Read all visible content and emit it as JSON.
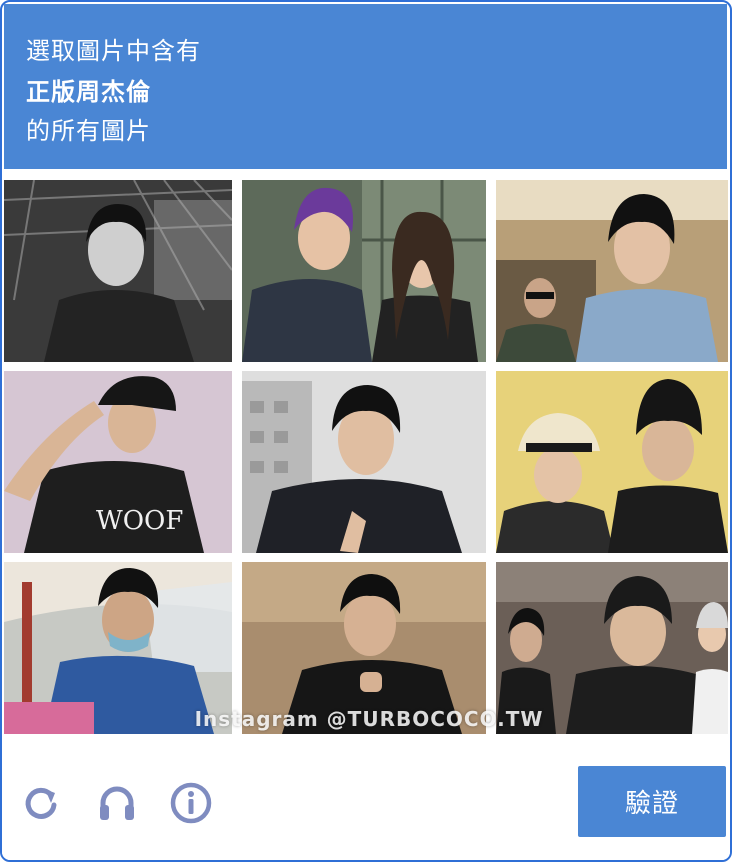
{
  "prompt": {
    "line1": "選取圖片中含有",
    "line2": "正版周杰倫",
    "line3": "的所有圖片"
  },
  "watermark": "Instagram @TURBOCOCO.TW",
  "footer": {
    "reload_icon": "reload-icon",
    "audio_icon": "headphones-icon",
    "info_icon": "info-icon",
    "verify_label": "驗證"
  },
  "colors": {
    "accent": "#4a86d4",
    "icon": "#7f8cc0"
  },
  "tiles": [
    {
      "row": 1,
      "col": 1,
      "subject": "man in dark jacket with industrial ceiling"
    },
    {
      "row": 1,
      "col": 2,
      "subject": "man with purple hair and woman posing"
    },
    {
      "row": 1,
      "col": 3,
      "subject": "man in denim jacket with man in sunglasses"
    },
    {
      "row": 2,
      "col": 1,
      "subject": "man in black cap and black t-shirt"
    },
    {
      "row": 2,
      "col": 2,
      "subject": "man in leather jacket making peace sign"
    },
    {
      "row": 2,
      "col": 3,
      "subject": "older woman in hat with man in black beanie"
    },
    {
      "row": 3,
      "col": 1,
      "subject": "man in blue jacket and mask at food stall"
    },
    {
      "row": 3,
      "col": 2,
      "subject": "man in black jacket seated"
    },
    {
      "row": 3,
      "col": 3,
      "subject": "man with friends at event"
    }
  ]
}
